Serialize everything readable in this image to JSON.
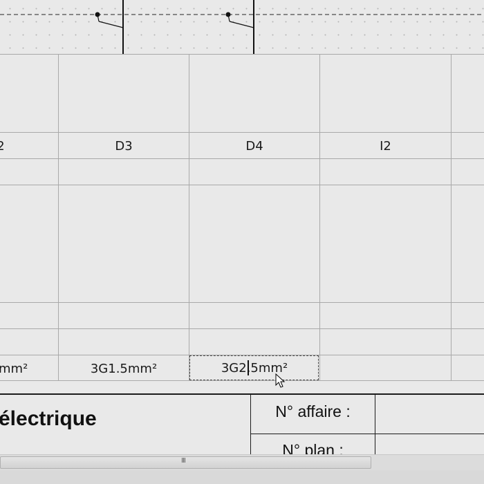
{
  "grid": {
    "labels": [
      "2",
      "D3",
      "D4",
      "I2"
    ],
    "cables": [
      "mm²",
      "3G1.5mm²",
      "3G2.5mm²"
    ]
  },
  "cartouche": {
    "title": "électrique",
    "affaire_label": "N° affaire :",
    "plan_label": "N° plan :"
  },
  "scrollbar": {
    "grip": "III"
  }
}
